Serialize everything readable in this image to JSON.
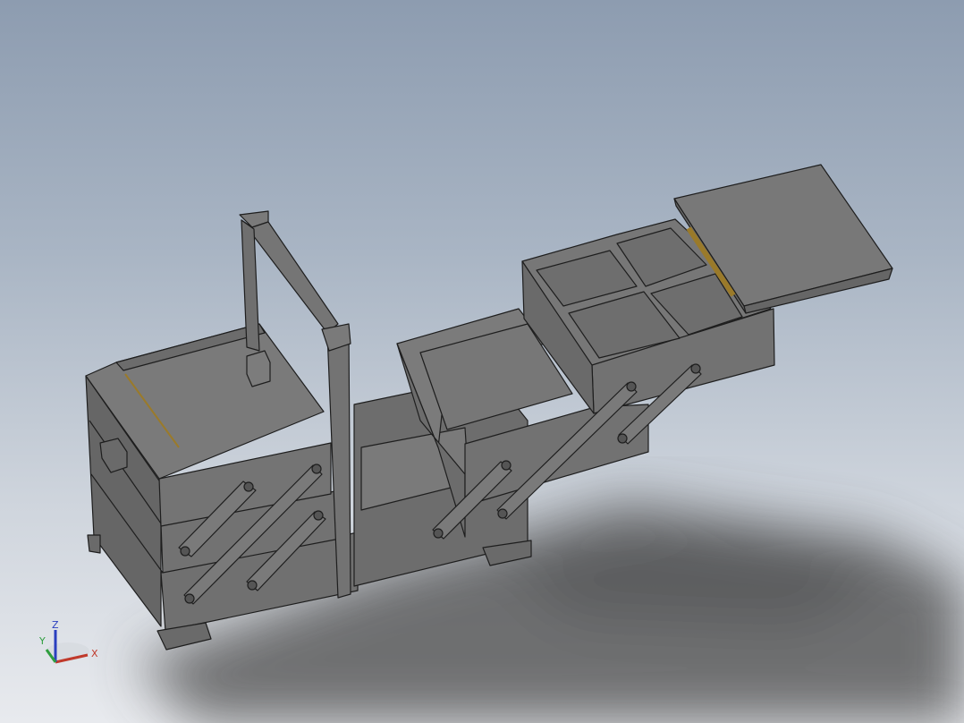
{
  "viewport": {
    "background_top": "#8d9cb0",
    "background_bottom": "#e8eaee"
  },
  "model": {
    "body_color": "#6f6f6f",
    "edge_color": "#1e1e1e",
    "hinge_color": "#9a7a2a"
  },
  "triad": {
    "x_label": "X",
    "y_label": "Y",
    "z_label": "Z",
    "x_color": "#c0392b",
    "y_color": "#2e9e3e",
    "z_color": "#2a3fbf"
  }
}
